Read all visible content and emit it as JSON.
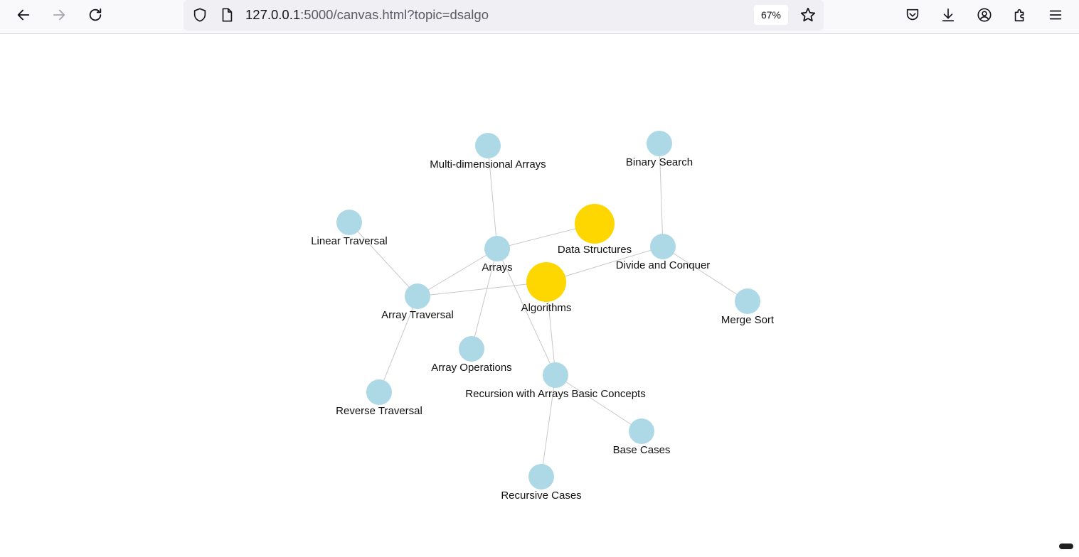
{
  "browser": {
    "url_host": "127.0.0.1",
    "url_rest": ":5000/canvas.html?topic=dsalgo",
    "zoom": "67%",
    "icons": {
      "back": "arrow-left-icon",
      "forward": "arrow-right-icon",
      "reload": "reload-icon",
      "shield": "shield-icon",
      "page": "page-icon",
      "bookmark": "star-icon",
      "pocket": "pocket-icon",
      "downloads": "download-icon",
      "account": "account-icon",
      "extensions": "puzzle-icon",
      "menu": "hamburger-menu-icon"
    }
  },
  "graph": {
    "colors": {
      "root": "#FFD700",
      "child": "#ADD8E6",
      "edge": "#c8c8c8",
      "label": "#111111"
    },
    "nodes": [
      {
        "id": "data-structures",
        "label": "Data Structures",
        "kind": "root"
      },
      {
        "id": "algorithms",
        "label": "Algorithms",
        "kind": "root"
      },
      {
        "id": "arrays",
        "label": "Arrays",
        "kind": "child"
      },
      {
        "id": "multi-dim",
        "label": "Multi-dimensional Arrays",
        "kind": "child"
      },
      {
        "id": "binary-search",
        "label": "Binary Search",
        "kind": "child"
      },
      {
        "id": "linear-traversal",
        "label": "Linear Traversal",
        "kind": "child"
      },
      {
        "id": "divide-conquer",
        "label": "Divide and Conquer",
        "kind": "child"
      },
      {
        "id": "array-traversal",
        "label": "Array Traversal",
        "kind": "child"
      },
      {
        "id": "merge-sort",
        "label": "Merge Sort",
        "kind": "child"
      },
      {
        "id": "array-operations",
        "label": "Array Operations",
        "kind": "child"
      },
      {
        "id": "recursion-arrays",
        "label": "Recursion with Arrays Basic Concepts",
        "kind": "child"
      },
      {
        "id": "reverse-traversal",
        "label": "Reverse Traversal",
        "kind": "child"
      },
      {
        "id": "base-cases",
        "label": "Base Cases",
        "kind": "child"
      },
      {
        "id": "recursive-cases",
        "label": "Recursive Cases",
        "kind": "child"
      }
    ],
    "edges": [
      [
        "arrays",
        "data-structures"
      ],
      [
        "arrays",
        "multi-dim"
      ],
      [
        "arrays",
        "array-traversal"
      ],
      [
        "arrays",
        "array-operations"
      ],
      [
        "arrays",
        "recursion-arrays"
      ],
      [
        "array-traversal",
        "algorithms"
      ],
      [
        "array-traversal",
        "linear-traversal"
      ],
      [
        "array-traversal",
        "reverse-traversal"
      ],
      [
        "algorithms",
        "divide-conquer"
      ],
      [
        "algorithms",
        "recursion-arrays"
      ],
      [
        "divide-conquer",
        "binary-search"
      ],
      [
        "divide-conquer",
        "merge-sort"
      ],
      [
        "recursion-arrays",
        "base-cases"
      ],
      [
        "recursion-arrays",
        "recursive-cases"
      ]
    ]
  }
}
